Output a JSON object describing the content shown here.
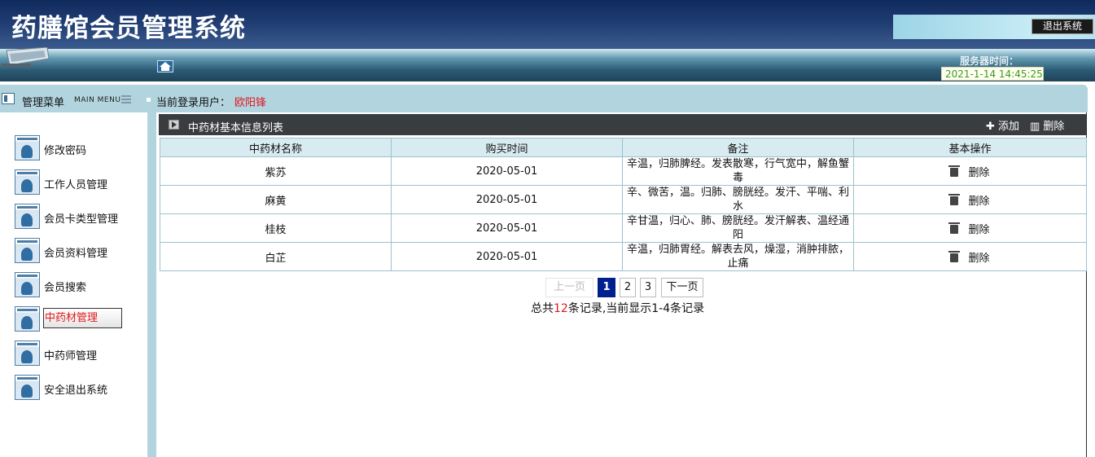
{
  "header": {
    "title": "药膳馆会员管理系统",
    "exit_label": "退出系统",
    "server_time_label": "服务器时间：",
    "server_time_value": "2021-1-14 14:45:25"
  },
  "menu_bar": {
    "title": "管理菜单",
    "title_en": "MAIN MENU",
    "current_user_label": "当前登录用户：",
    "current_user_name": "欧阳锋"
  },
  "sidebar": {
    "items": [
      {
        "label": "修改密码",
        "active": false
      },
      {
        "label": "工作人员管理",
        "active": false
      },
      {
        "label": "会员卡类型管理",
        "active": false
      },
      {
        "label": "会员资料管理",
        "active": false
      },
      {
        "label": "会员搜索",
        "active": false
      },
      {
        "label": "中药材管理",
        "active": true
      },
      {
        "label": "中药师管理",
        "active": false
      },
      {
        "label": "安全退出系统",
        "active": false
      }
    ]
  },
  "panel": {
    "title": "中药材基本信息列表",
    "add_label": "✚ 添加",
    "delete_label": "▥ 删除"
  },
  "table": {
    "headers": [
      "中药材名称",
      "购买时间",
      "备注",
      "基本操作"
    ],
    "rows": [
      {
        "name": "紫苏",
        "date": "2020-05-01",
        "remark": "辛温，归肺脾经。发表散寒，行气宽中，解鱼蟹毒",
        "action": "删除"
      },
      {
        "name": "麻黄",
        "date": "2020-05-01",
        "remark": "辛、微苦，温。归肺、膀胱经。发汗、平喘、利水",
        "action": "删除"
      },
      {
        "name": "桂枝",
        "date": "2020-05-01",
        "remark": "辛甘温，归心、肺、膀胱经。发汗解表、温经通阳",
        "action": "删除"
      },
      {
        "name": "白芷",
        "date": "2020-05-01",
        "remark": "辛温，归肺胃经。解表去风，燥湿，消肿排脓，止痛",
        "action": "删除"
      }
    ]
  },
  "pagination": {
    "prev": "上一页",
    "pages": [
      "1",
      "2",
      "3"
    ],
    "current_page": "1",
    "next": "下一页",
    "summary_prefix": "总共",
    "summary_count": "12",
    "summary_suffix": "条记录,当前显示1-4条记录"
  },
  "colors": {
    "header_bg": "#1f3c72",
    "menu_bar_bg": "#b2d4de",
    "panel_header_bg": "#3a3d40",
    "table_header_bg": "#d8ebf0",
    "active_page_bg": "#001f8f",
    "highlight_red": "#e0191d"
  }
}
